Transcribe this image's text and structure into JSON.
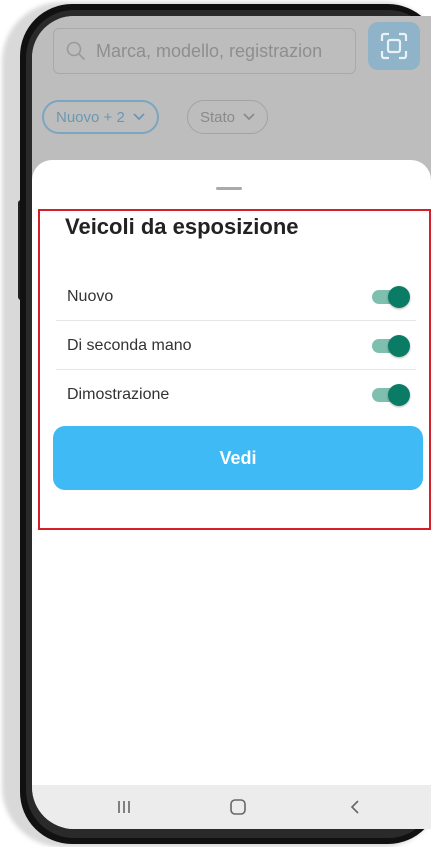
{
  "app": {
    "search": {
      "placeholder": "Marca, modello, registrazion"
    },
    "chips": {
      "condition_label": "Nuovo + 2",
      "state_label": "Stato"
    }
  },
  "sheet": {
    "title": "Veicoli da esposizione",
    "options": [
      {
        "label": "Nuovo",
        "enabled": true
      },
      {
        "label": "Di seconda mano",
        "enabled": true
      },
      {
        "label": "Dimostrazione",
        "enabled": true
      }
    ],
    "confirm_label": "Vedi"
  },
  "navbar": {
    "icons": [
      "recent-apps-icon",
      "home-icon",
      "back-icon"
    ]
  },
  "colors": {
    "accent": "#3fbaf5",
    "toggle_on": "#0a7c66",
    "toggle_track": "#7fbfb0",
    "highlight": "#d21f2a"
  }
}
